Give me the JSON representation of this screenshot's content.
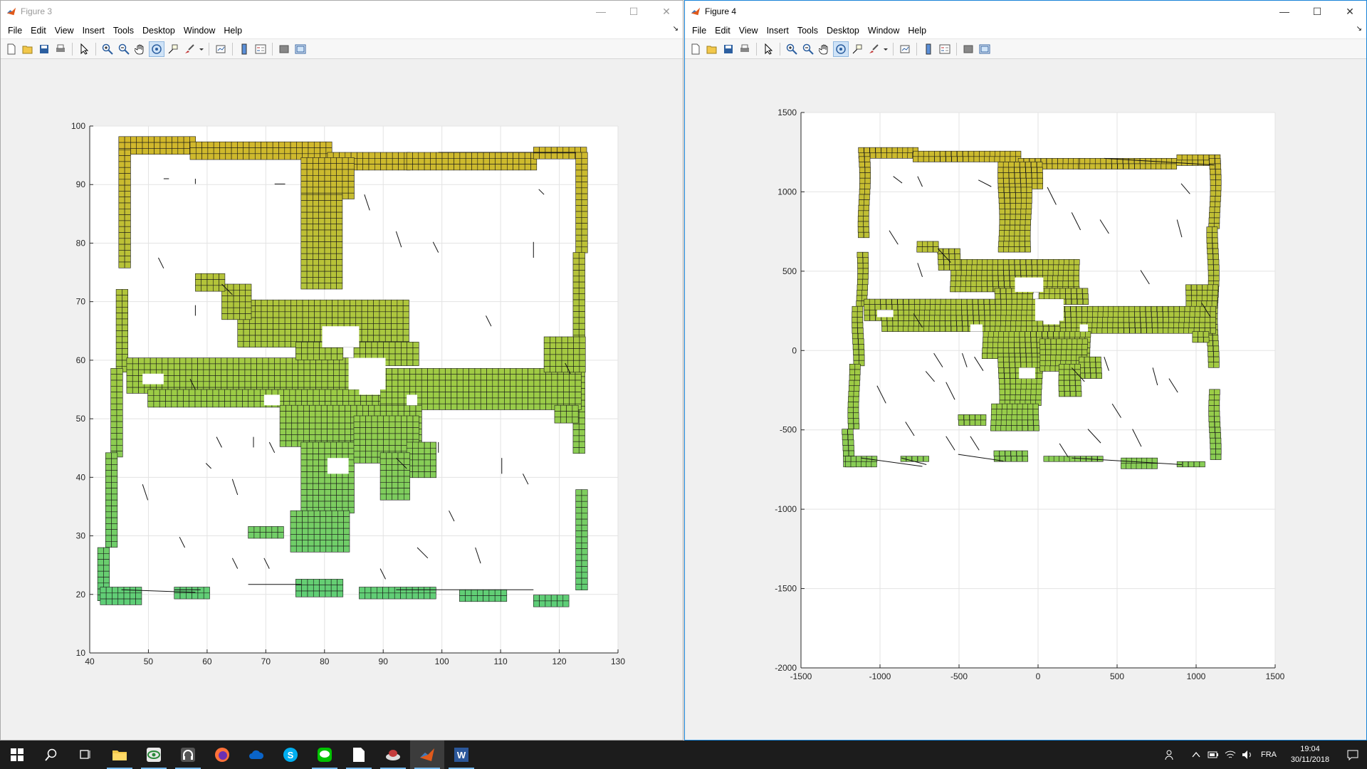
{
  "windows": [
    {
      "title": "Figure 3",
      "menus": [
        "File",
        "Edit",
        "View",
        "Insert",
        "Tools",
        "Desktop",
        "Window",
        "Help"
      ],
      "plot": {
        "xticks": [
          "40",
          "50",
          "60",
          "70",
          "80",
          "90",
          "100",
          "110",
          "120",
          "130"
        ],
        "yticks": [
          "100",
          "90",
          "80",
          "70",
          "60",
          "50",
          "40",
          "30",
          "20",
          "10"
        ],
        "xlim": [
          40,
          130
        ],
        "ylim": [
          10,
          100
        ]
      }
    },
    {
      "title": "Figure 4",
      "menus": [
        "File",
        "Edit",
        "View",
        "Insert",
        "Tools",
        "Desktop",
        "Window",
        "Help"
      ],
      "plot": {
        "xticks": [
          "-1500",
          "-1000",
          "-500",
          "0",
          "500",
          "1000",
          "1500"
        ],
        "yticks": [
          "1500",
          "1000",
          "500",
          "0",
          "-500",
          "-1000",
          "-1500",
          "-2000"
        ],
        "xlim": [
          -1500,
          1500
        ],
        "ylim": [
          -2000,
          1500
        ]
      }
    }
  ],
  "taskbar": {
    "apps": [
      "start-icon",
      "search-icon",
      "task-view-icon",
      "file-explorer-icon",
      "app-eye-icon",
      "headphones-icon",
      "firefox-icon",
      "app-cloud-icon",
      "skype-icon",
      "line-icon",
      "notepad-icon",
      "app-hat-icon",
      "matlab-icon",
      "word-icon"
    ],
    "language": "FRA",
    "time": "19:04",
    "date": "30/11/2018"
  },
  "colors": {
    "titlebar": "#ffffff",
    "active_border": "#1883d7",
    "grid_top": "#d4b72a",
    "grid_mid": "#9ccc46",
    "grid_bottom": "#4fcf84"
  }
}
